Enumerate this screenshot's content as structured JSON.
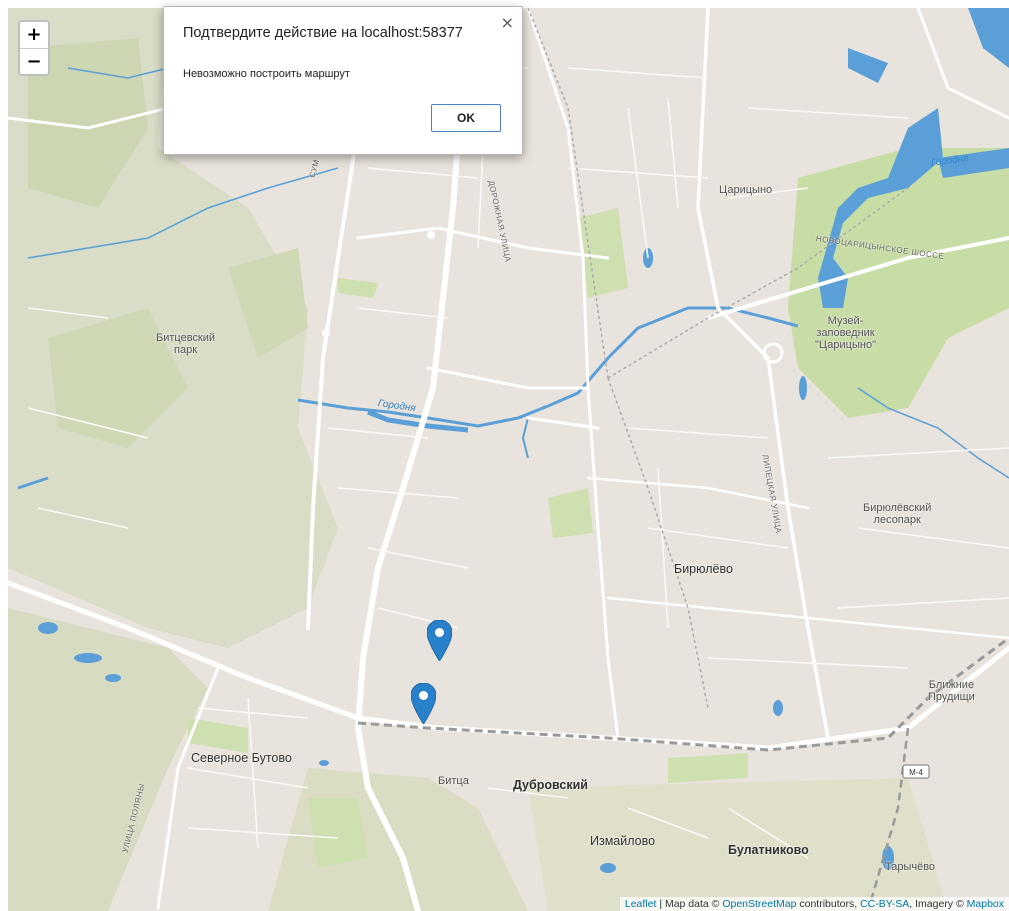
{
  "dialog": {
    "title": "Подтвердите действие на localhost:58377",
    "message": "Невозможно построить маршрут",
    "ok_label": "OK",
    "close_label": "×"
  },
  "zoom": {
    "in_label": "+",
    "out_label": "−"
  },
  "map": {
    "places": [
      {
        "id": "tsaritsyno",
        "text": "Царицыно"
      },
      {
        "id": "bitsevsky-park",
        "text": "Битцевский\nпарк"
      },
      {
        "id": "museum",
        "text": "Музей-\nзаповедник\n\"Царицыно\""
      },
      {
        "id": "biryulevsky-forest",
        "text": "Бирюлёвский\nлесопарк"
      },
      {
        "id": "biryulevo",
        "text": "Бирюлёво"
      },
      {
        "id": "blizhnie-prudishchi",
        "text": "Ближние\nПрудищи"
      },
      {
        "id": "severnoe-butovo",
        "text": "Северное Бутово"
      },
      {
        "id": "bitsa",
        "text": "Битца"
      },
      {
        "id": "dubrovsky",
        "text": "Дубровский"
      },
      {
        "id": "izmaylovo",
        "text": "Измайлово"
      },
      {
        "id": "bulatnikovo",
        "text": "Булатниково"
      },
      {
        "id": "tarychevo",
        "text": "Тарычёво"
      }
    ],
    "streets": [
      {
        "id": "dorozhnaya",
        "text": "ДОРОЖНАЯ УЛИЦА"
      },
      {
        "id": "novotsaritsynskoe",
        "text": "НОВОЦАРИЦЫНСКОЕ ШОССЕ"
      },
      {
        "id": "lipetskaya",
        "text": "ЛИПЕЦКАЯ УЛИЦА"
      },
      {
        "id": "ulitsa-polyany",
        "text": "УЛИЦА ПОЛЯНЫ"
      },
      {
        "id": "sumskaya",
        "text": "СУМ"
      }
    ],
    "rivers": [
      {
        "id": "gorodnya-center",
        "text": "Городня"
      },
      {
        "id": "gorodnya-east",
        "text": "Городня"
      }
    ],
    "highway_shield": "М-4",
    "markers": [
      {
        "id": "marker-1"
      },
      {
        "id": "marker-2"
      }
    ]
  },
  "attribution": {
    "leaflet": "Leaflet",
    "map_data_prefix": "| Map data ©",
    "osm": "OpenStreetMap",
    "contributors": "contributors,",
    "license": "CC-BY-SA",
    "imagery_prefix": ", Imagery ©",
    "mapbox": "Mapbox"
  },
  "colors": {
    "water": "#5a9fd8",
    "park": "#cfe0b0",
    "road": "#ffffff",
    "marker": "#2a81cb",
    "dialog_button_border": "#4a7fc9"
  }
}
